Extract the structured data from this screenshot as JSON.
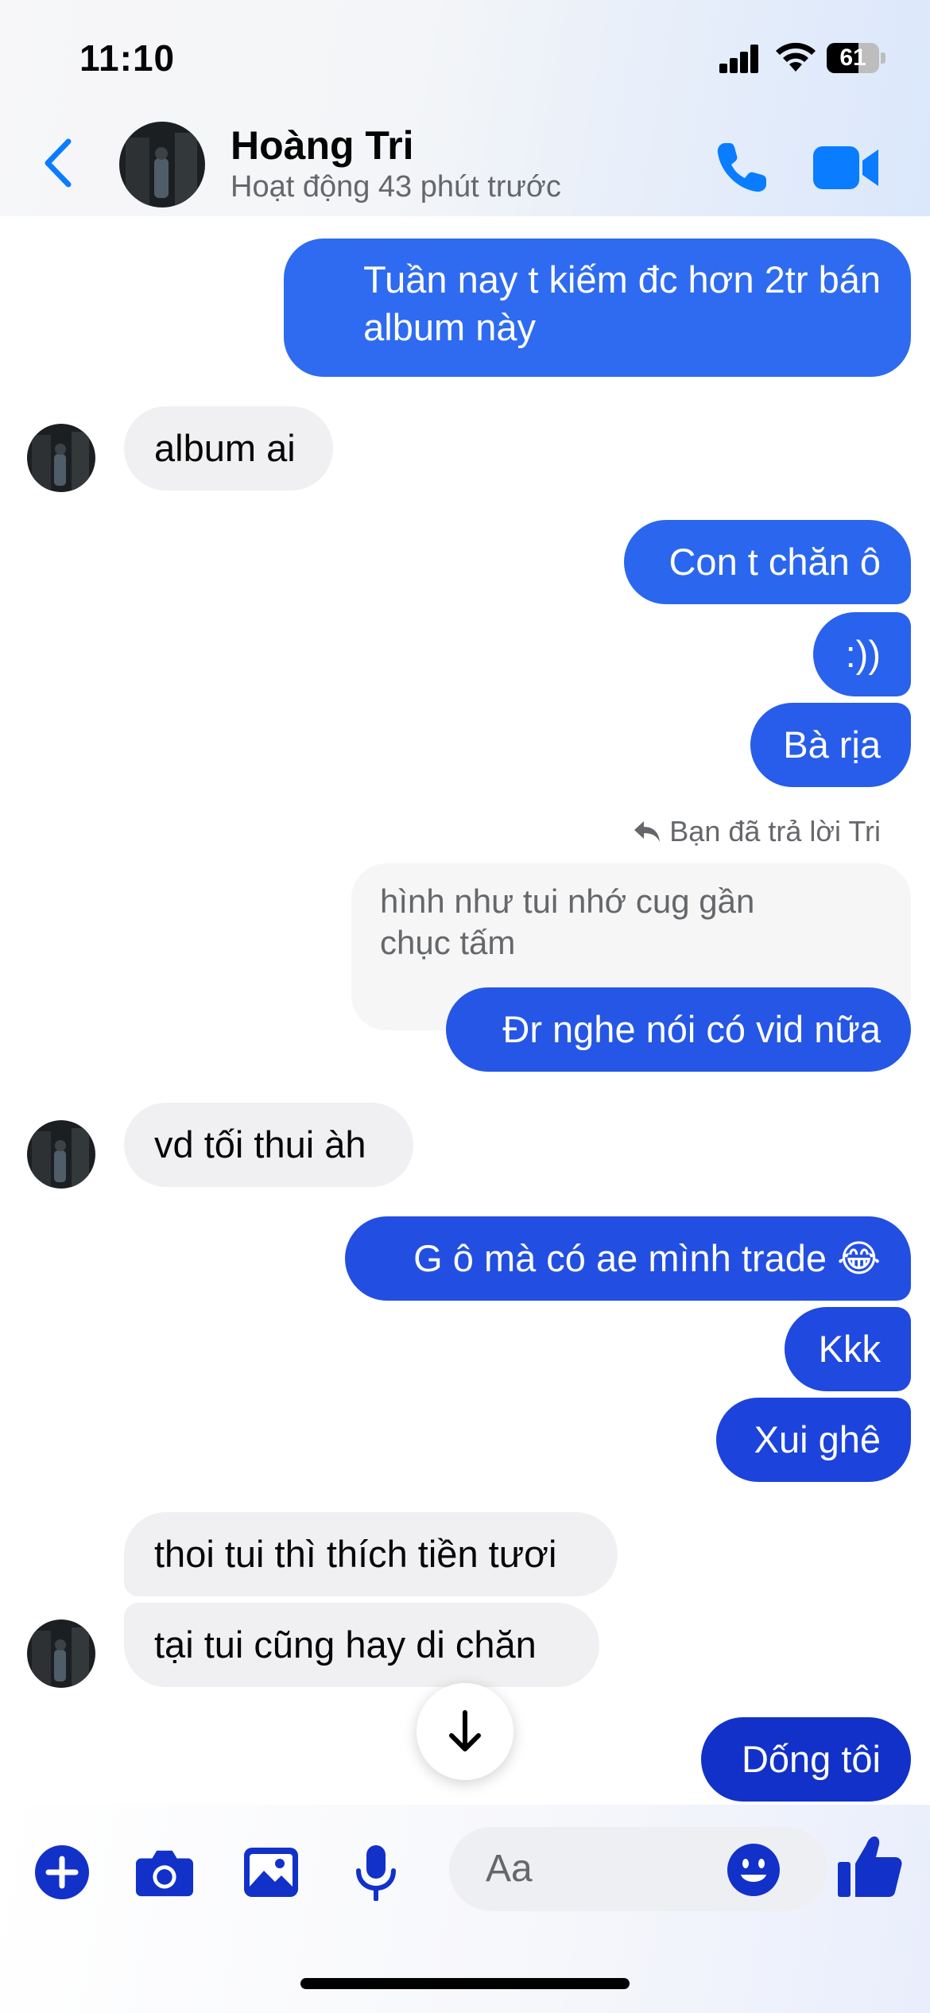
{
  "status_bar": {
    "time": "11:10",
    "battery": "61",
    "battery_level": 0.61
  },
  "header": {
    "name": "Hoàng Tri",
    "status": "Hoạt động 43 phút trước"
  },
  "colors": {
    "accent": "#0a7cff",
    "outgoing_top": "#2e6bf0",
    "outgoing_bottom": "#1231c8",
    "incoming_bg": "#f0f0f2"
  },
  "messages": [
    {
      "from": "me",
      "line1": "Tuần nay t kiếm đc hơn 2tr bán",
      "line2": "album này"
    },
    {
      "from": "them",
      "text": "album ai"
    },
    {
      "from": "me",
      "text": "Con t chăn ô"
    },
    {
      "from": "me",
      "text": ":))"
    },
    {
      "from": "me",
      "text": "Bà rịa"
    },
    {
      "from": "me",
      "reply_label": "Bạn đã trả lời Tri",
      "quoted_line1": "hình như tui nhớ cug gần",
      "quoted_line2": "chục tấm",
      "text": "Đr nghe nói có vid nữa"
    },
    {
      "from": "them",
      "text": "vd tối thui àh"
    },
    {
      "from": "me",
      "text": "G ô mà có ae mình trade 😂"
    },
    {
      "from": "me",
      "text": "Kkk"
    },
    {
      "from": "me",
      "text": "Xui ghê"
    },
    {
      "from": "them",
      "text": "thoi tui thì thích tiền tươi"
    },
    {
      "from": "them",
      "text": "tại tui cũng hay di chăn"
    },
    {
      "from": "me",
      "text": "Dống tôi"
    }
  ],
  "composer": {
    "placeholder": "Aa"
  },
  "icons": [
    "back-chevron-icon",
    "phone-icon",
    "video-camera-icon",
    "plus-icon",
    "camera-icon",
    "gallery-icon",
    "microphone-icon",
    "emoji-icon",
    "thumbs-up-icon",
    "arrow-down-icon",
    "reply-arrow-icon"
  ]
}
